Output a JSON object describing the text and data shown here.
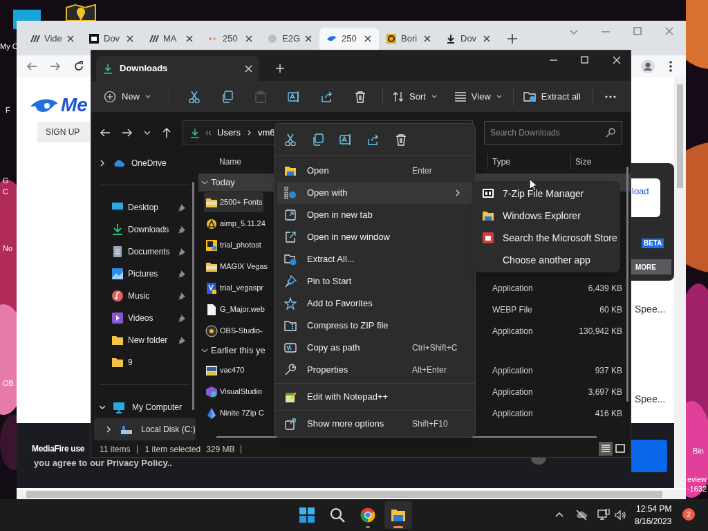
{
  "desktop": {
    "left_labels": [
      "My C",
      "F",
      "G",
      "C",
      "No",
      "OB"
    ],
    "right_labels": [
      "Bin",
      "eview",
      "-1632"
    ]
  },
  "browser": {
    "tabs": [
      {
        "title": "Vide",
        "selected": false
      },
      {
        "title": "Dov",
        "selected": false
      },
      {
        "title": "MA",
        "selected": false
      },
      {
        "title": "250",
        "selected": false
      },
      {
        "title": "E2G",
        "selected": false
      },
      {
        "title": "250",
        "selected": true
      },
      {
        "title": "Bori",
        "selected": false
      },
      {
        "title": "Dov",
        "selected": false
      }
    ],
    "page": {
      "logo_text": "Me",
      "sign_up": "SIGN UP",
      "download_button": "load",
      "badge": "BETA",
      "more_button": "MORE",
      "speed_texts": [
        "Spee...",
        "Spee..."
      ],
      "cookie_lines": [
        "MediaFire use",
        "you agree to our Privacy Policy.."
      ]
    }
  },
  "explorer": {
    "tab_title": "Downloads",
    "toolbar": {
      "new_label": "New",
      "actions": [
        {
          "disabled": false
        },
        {
          "disabled": false
        },
        {
          "disabled": true
        },
        {
          "disabled": false
        },
        {
          "disabled": false
        },
        {
          "disabled": false
        }
      ],
      "sort_label": "Sort",
      "view_label": "View",
      "extract_label": "Extract all"
    },
    "address": {
      "crumbs": [
        "Users",
        "vm6"
      ]
    },
    "search": {
      "placeholder": "Search Downloads"
    },
    "nav": {
      "onedrive": {
        "label": "OneDrive",
        "expanded": false
      },
      "quick_access": [
        {
          "label": "Desktop",
          "pinned": true
        },
        {
          "label": "Downloads",
          "pinned": true
        },
        {
          "label": "Documents",
          "pinned": true
        },
        {
          "label": "Pictures",
          "pinned": true
        },
        {
          "label": "Music",
          "pinned": true
        },
        {
          "label": "Videos",
          "pinned": true
        },
        {
          "label": "New folder",
          "pinned": true
        },
        {
          "label": "9",
          "pinned": false
        }
      ],
      "computer": {
        "label": "My Computer",
        "expanded": true,
        "children": [
          {
            "label": "Local Disk (C:)",
            "expanded": false,
            "selected": true
          }
        ]
      }
    },
    "columns": [
      "Name",
      "Type",
      "Size"
    ],
    "groups": [
      {
        "label": "Today",
        "expanded": true,
        "highlighted": true,
        "files": [
          {
            "name": "2500+ Fonts",
            "selected": true
          },
          {
            "name": "aimp_5.11.24",
            "selected": false
          },
          {
            "name": "trial_photost",
            "selected": false
          },
          {
            "name": "MAGIX Vegas",
            "selected": false
          },
          {
            "name": "trial_vegaspr",
            "type": "Application",
            "size": "6,439 KB",
            "selected": false
          },
          {
            "name": "G_Major.web",
            "type": "WEBP File",
            "size": "60 KB",
            "selected": false
          },
          {
            "name": "OBS-Studio-",
            "type": "Application",
            "size": "130,942 KB",
            "selected": false
          }
        ]
      },
      {
        "label": "Earlier this ye",
        "expanded": true,
        "highlighted": false,
        "files": [
          {
            "name": "vac470",
            "type": "Application",
            "size": "937 KB",
            "selected": false
          },
          {
            "name": "VisualStudio",
            "type": "Application",
            "size": "3,697 KB",
            "selected": false
          },
          {
            "name": "Ninite 7Zip C",
            "type": "Application",
            "size": "416 KB",
            "selected": false
          }
        ]
      }
    ],
    "status": {
      "items": "11 items",
      "selection": "1 item selected",
      "size": "329 MB"
    },
    "views": [
      {
        "selected": true
      },
      {
        "selected": false
      }
    ]
  },
  "context_menu": {
    "sections": [
      [
        {
          "label": "Open",
          "shortcut": "Enter",
          "has_submenu": false,
          "highlighted": false
        },
        {
          "label": "Open with",
          "has_submenu": true,
          "highlighted": true
        },
        {
          "label": "Open in new tab",
          "has_submenu": false,
          "highlighted": false
        },
        {
          "label": "Open in new window",
          "has_submenu": false,
          "highlighted": false
        },
        {
          "label": "Extract All...",
          "has_submenu": false,
          "highlighted": false
        },
        {
          "label": "Pin to Start",
          "has_submenu": false,
          "highlighted": false
        },
        {
          "label": "Add to Favorites",
          "has_submenu": false,
          "highlighted": false
        },
        {
          "label": "Compress to ZIP file",
          "has_submenu": false,
          "highlighted": false
        },
        {
          "label": "Copy as path",
          "shortcut": "Ctrl+Shift+C",
          "has_submenu": false,
          "highlighted": false
        },
        {
          "label": "Properties",
          "shortcut": "Alt+Enter",
          "has_submenu": false,
          "highlighted": false
        }
      ],
      [
        {
          "label": "Edit with Notepad++",
          "has_submenu": false,
          "highlighted": false
        }
      ],
      [
        {
          "label": "Show more options",
          "shortcut": "Shift+F10",
          "has_submenu": false,
          "highlighted": false
        }
      ]
    ],
    "submenu": [
      {
        "label": "7-Zip File Manager"
      },
      {
        "label": "Windows Explorer"
      },
      {
        "label": "Search the Microsoft Store"
      },
      {
        "label": "Choose another app"
      }
    ]
  },
  "taskbar": {
    "apps": [
      {
        "running": false,
        "active": false
      },
      {
        "running": false,
        "active": false
      },
      {
        "running": true,
        "active": false
      },
      {
        "running": true,
        "active": true
      }
    ],
    "time": "12:54 PM",
    "date": "8/16/2023",
    "notifications": "2"
  }
}
